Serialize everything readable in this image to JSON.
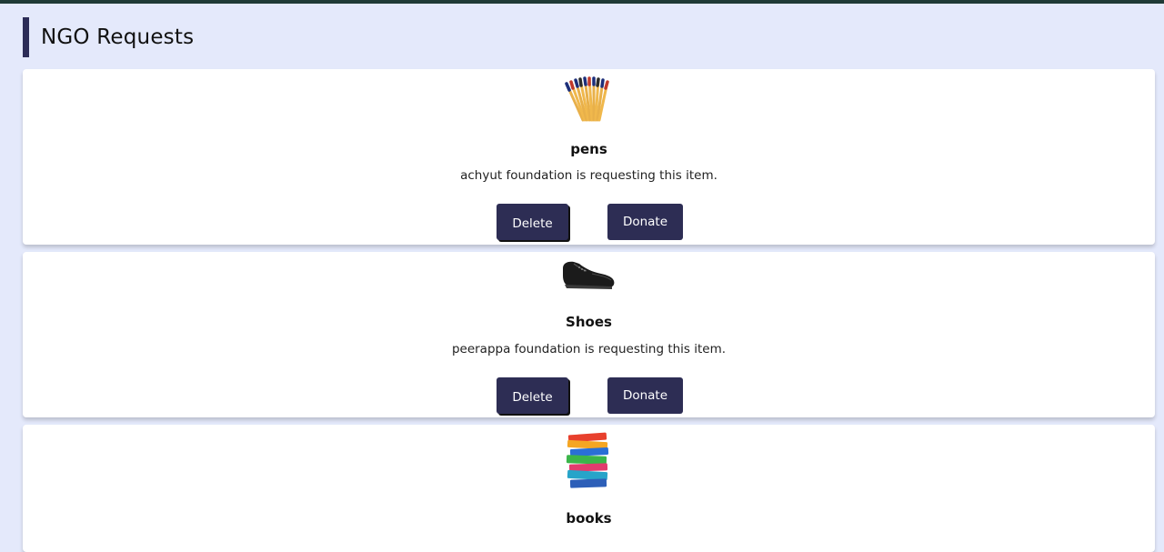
{
  "page": {
    "title": "NGO Requests"
  },
  "requests": [
    {
      "item": "pens",
      "description": "achyut foundation is requesting this item.",
      "image_icon": "pens-image",
      "delete_label": "Delete",
      "donate_label": "Donate"
    },
    {
      "item": "Shoes",
      "description": "peerappa foundation is requesting this item.",
      "image_icon": "shoe-image",
      "delete_label": "Delete",
      "donate_label": "Donate"
    },
    {
      "item": "books",
      "description": "",
      "image_icon": "books-image"
    }
  ],
  "colors": {
    "background": "#e4e9fb",
    "accent": "#2c2c57",
    "button": "#2d2d54",
    "topbar": "#1f3a36",
    "card": "#ffffff"
  }
}
